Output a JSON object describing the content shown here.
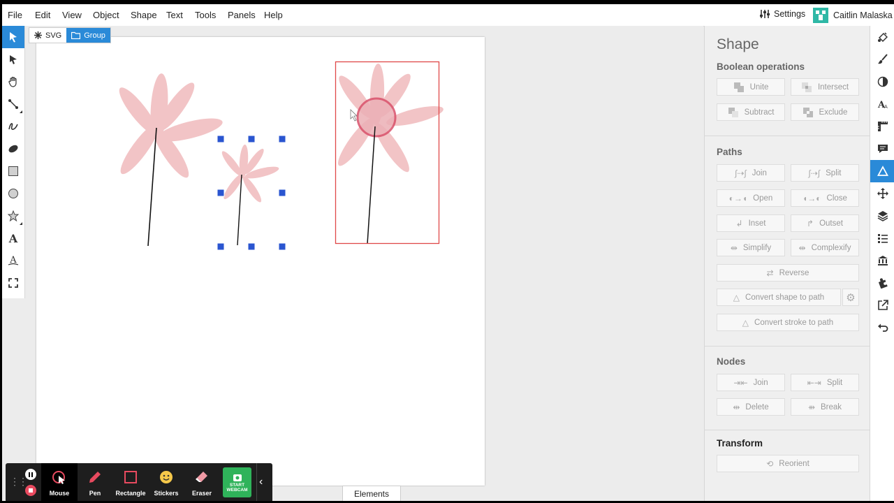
{
  "menubar": {
    "items": [
      "File",
      "Edit",
      "View",
      "Object",
      "Shape",
      "Text",
      "Tools",
      "Panels",
      "Help"
    ],
    "settings_label": "Settings",
    "user_name": "Caitlin Malaska"
  },
  "breadcrumb": {
    "svg_label": "SVG",
    "group_label": "Group"
  },
  "left_tools": [
    "pointer-icon",
    "node-pointer-icon",
    "hand-icon",
    "line-icon",
    "freehand-icon",
    "brush-blob-icon",
    "rectangle-icon",
    "ellipse-icon",
    "star-icon",
    "text-icon",
    "text-on-path-icon",
    "crop-icon"
  ],
  "panel": {
    "title": "Shape",
    "boolean": {
      "title": "Boolean operations",
      "buttons": [
        "Unite",
        "Intersect",
        "Subtract",
        "Exclude"
      ]
    },
    "paths": {
      "title": "Paths",
      "buttons": [
        "Join",
        "Split",
        "Open",
        "Close",
        "Inset",
        "Outset",
        "Simplify",
        "Complexify",
        "Reverse",
        "Convert shape to path",
        "Convert stroke to path"
      ]
    },
    "nodes": {
      "title": "Nodes",
      "buttons": [
        "Join",
        "Split",
        "Delete",
        "Break"
      ]
    },
    "transform": {
      "title": "Transform",
      "buttons": [
        "Reorient"
      ]
    }
  },
  "right_rail": [
    "fill-bucket-icon",
    "brush-icon",
    "contrast-icon",
    "typography-icon",
    "ruler-icon",
    "comment-icon",
    "shape-triangle-icon",
    "move-icon",
    "layers-icon",
    "list-icon",
    "library-icon",
    "puzzle-icon",
    "export-icon",
    "undo-icon"
  ],
  "elements_tab_label": "Elements",
  "recorder": {
    "tools": [
      "Mouse",
      "Pen",
      "Rectangle",
      "Stickers",
      "Eraser"
    ],
    "webcam_label_1": "START",
    "webcam_label_2": "WEBCAM"
  },
  "colors": {
    "accent": "#2a8ad8",
    "petal": "#f2c4c6",
    "selection": "#e04848",
    "handle": "#2a55d0"
  }
}
